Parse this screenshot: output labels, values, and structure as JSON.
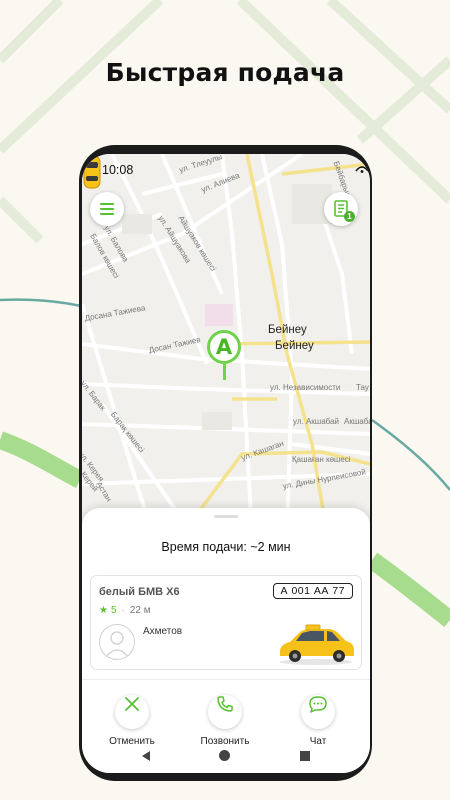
{
  "headline": "Быстрая подача",
  "status_bar": {
    "time": "10:08"
  },
  "map": {
    "city_labels": [
      "Бейнеу",
      "Бейнеу"
    ],
    "streets": [
      "ул. Тлеуулы",
      "ул. Алиева",
      "ул. Айшуакова",
      "Айшуаков көшесі",
      "ул. Балова",
      "Балов көшесі",
      "Досана Тажиева",
      "Досан Тажиев",
      "ул. Независимости",
      "ул. Акшабай",
      "Акшабай",
      "ул. Барак",
      "Барақ көшесі",
      "ул. Кашаган",
      "Қашаған көшесі",
      "ул. Дины Нурпеисовой",
      "Астан",
      "Бейбарыс",
      "Тау",
      "ул. Керея",
      "Керей"
    ],
    "pin_label": "A",
    "orders_badge": "1"
  },
  "sheet": {
    "wait_text": "Время подачи: ~2 мин",
    "car": {
      "model": "белый БМВ Х6",
      "plate": "А 001 АА 77",
      "rating": "5",
      "distance": "22 м",
      "driver_name": "Ахметов"
    },
    "actions": [
      {
        "label": "Отменить",
        "icon": "close-icon"
      },
      {
        "label": "Позвонить",
        "icon": "phone-icon"
      },
      {
        "label": "Чат",
        "icon": "chat-icon"
      }
    ]
  },
  "colors": {
    "accent": "#56c22f",
    "background": "#fbf8f1",
    "phone_frame": "#1b1b1b",
    "taxi_yellow": "#f6c21a"
  }
}
